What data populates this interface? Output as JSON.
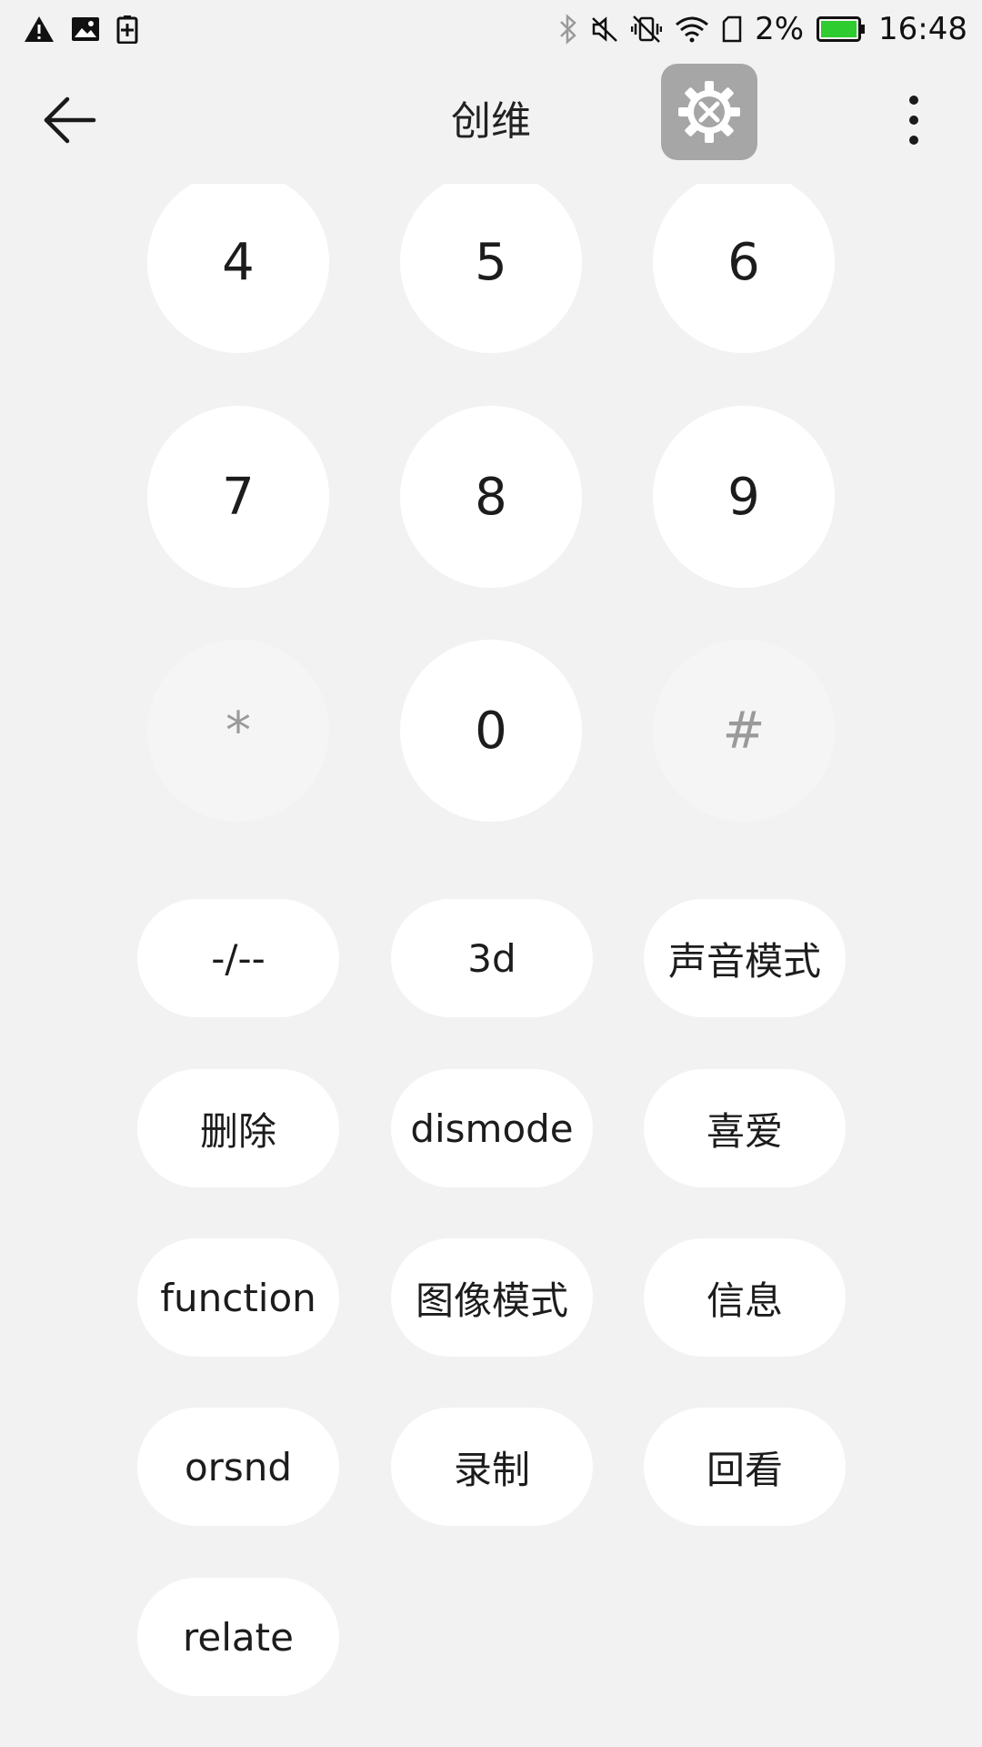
{
  "status_bar": {
    "battery_percent": "2%",
    "time": "16:48",
    "icons_left": [
      "warning-icon",
      "image-icon",
      "battery-saver-icon"
    ],
    "icons_right": [
      "bluetooth-icon",
      "mute-icon",
      "vibrate-off-icon",
      "wifi-icon",
      "sim-icon",
      "battery-icon"
    ],
    "battery_color": "#2ecc2e"
  },
  "toolbar": {
    "title": "创维",
    "back_icon": "back-arrow-icon",
    "settings_icon": "settings-tools-icon",
    "more_icon": "more-vertical-icon"
  },
  "keypad": {
    "keys": [
      "4",
      "5",
      "6",
      "7",
      "8",
      "9",
      "*",
      "0",
      "#"
    ]
  },
  "function_buttons": [
    "-/--",
    "3d",
    "声音模式",
    "删除",
    "dismode",
    "喜爱",
    "function",
    "图像模式",
    "信息",
    "orsnd",
    "录制",
    "回看",
    "relate"
  ],
  "colors": {
    "background": "#f2f2f2",
    "button": "#ffffff",
    "disabled_button": "#f5f5f5",
    "floating_settings": "#a6a6a6"
  }
}
